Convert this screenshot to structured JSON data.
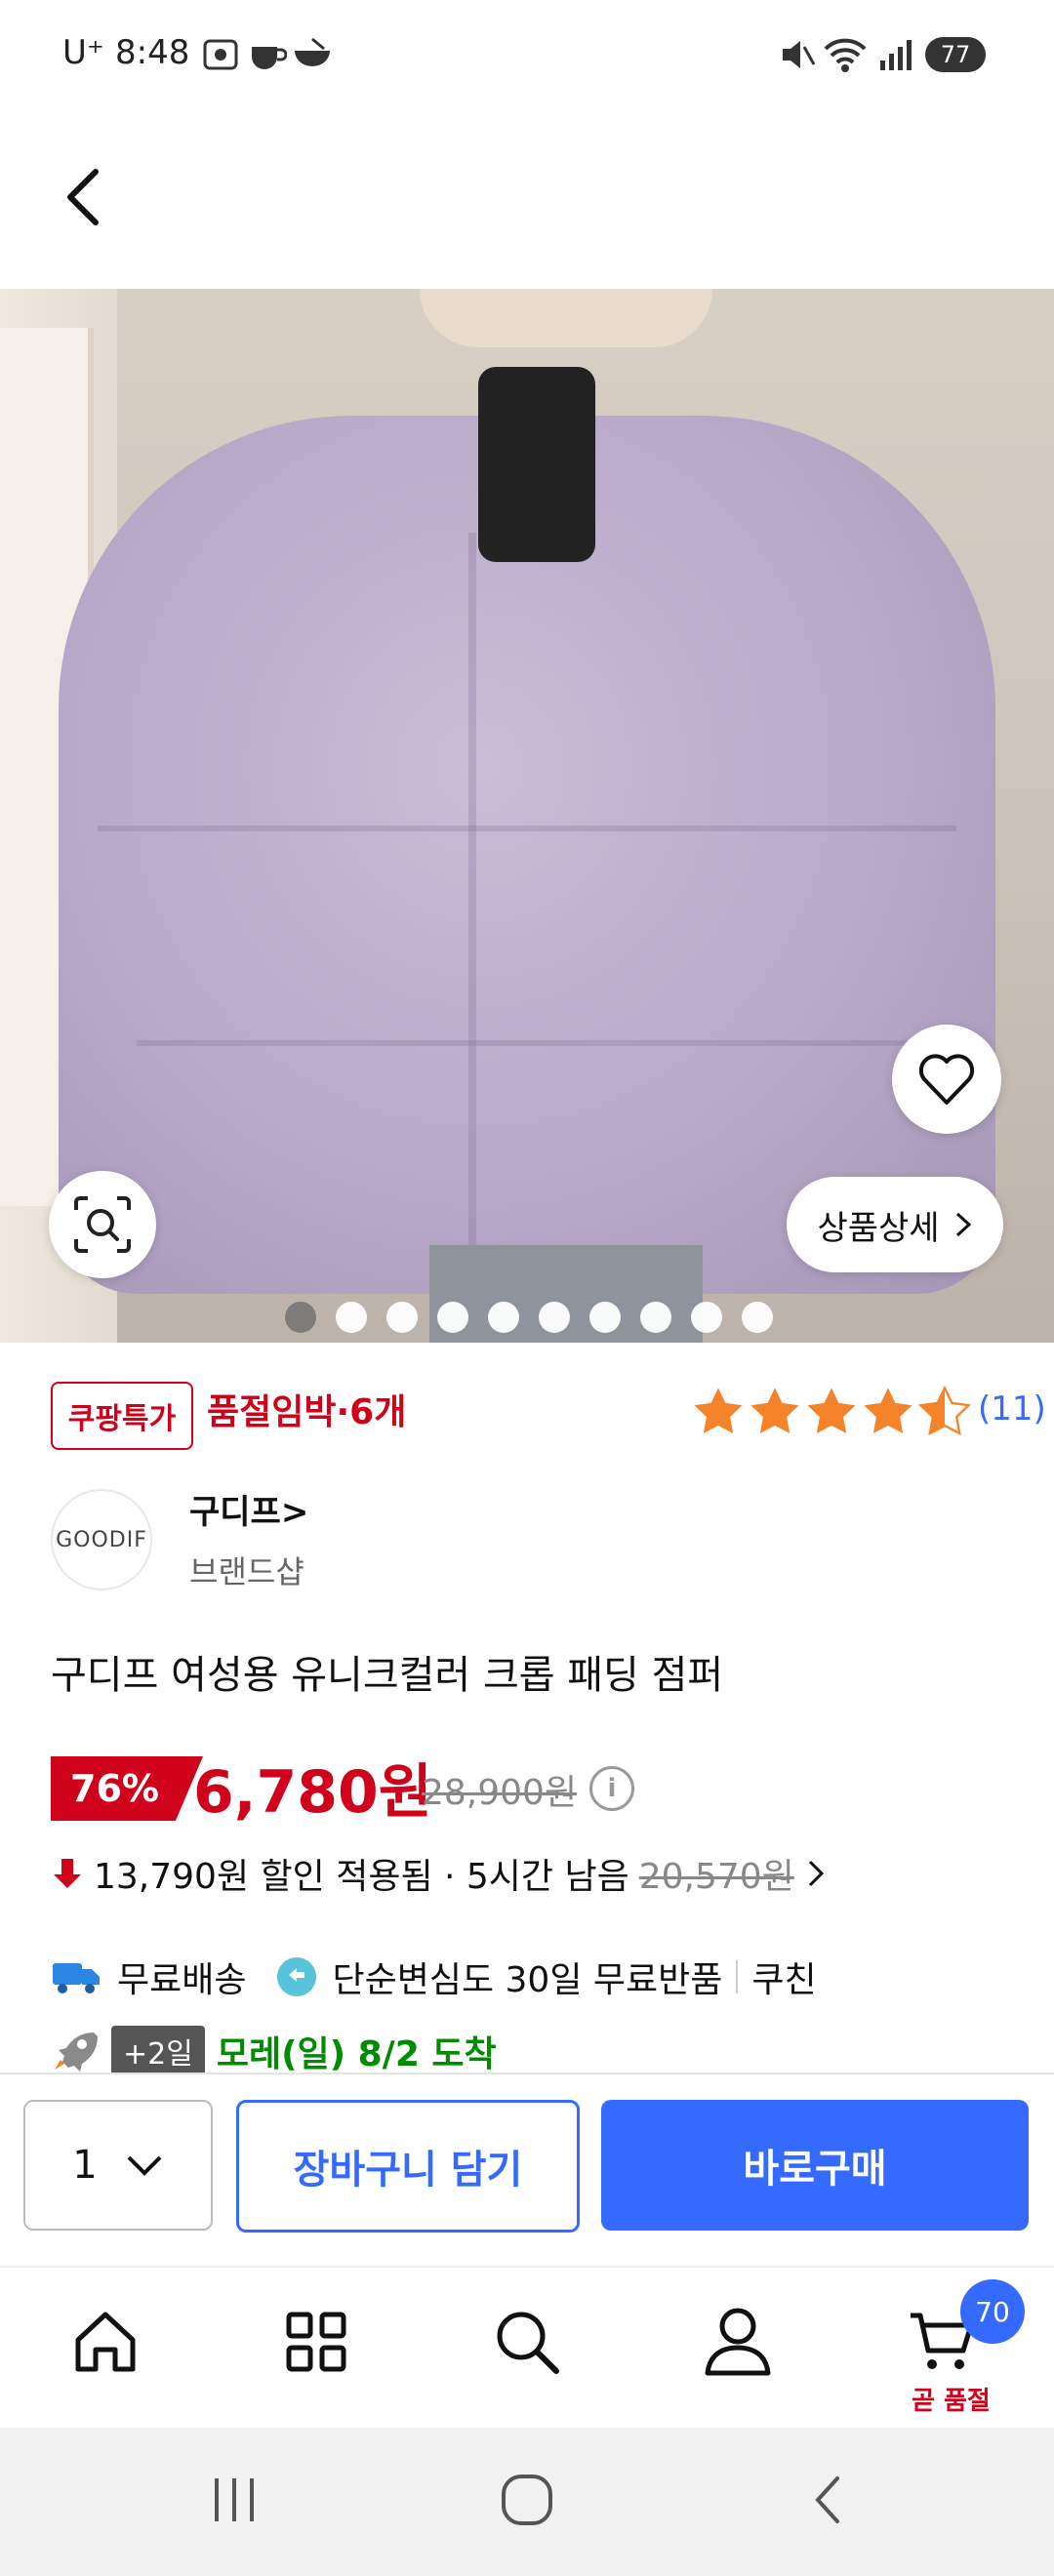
{
  "status_bar": {
    "carrier": "U⁺",
    "time": "8:48",
    "battery": "77"
  },
  "header": {
    "back_icon": "chevron-left-icon"
  },
  "product_image": {
    "detail_button_label": "상품상세",
    "image_count": 10,
    "active_index": 0
  },
  "badges": {
    "coupang_special": "쿠팡특가",
    "stock_status": "품절임박·6개"
  },
  "rating": {
    "stars": 4.5,
    "review_count": "(11)"
  },
  "brand": {
    "logo_text": "GOODIF",
    "name": "구디프>",
    "subtitle": "브랜드샵"
  },
  "product": {
    "title": "구디프 여성용 유니크컬러 크롭 패딩 점퍼",
    "discount": "76%",
    "price": "6,780원",
    "original_price": "28,900원",
    "coupon_text": "13,790원 할인 적용됨 · 5시간 남음",
    "coupon_strike": "20,570원"
  },
  "shipping": {
    "free_shipping": "무료배송",
    "return_text": "단순변심도 30일 무료반품",
    "coocheen": "쿠친",
    "plus_days": "+2일",
    "arrival": "모레(일) 8/2 도착"
  },
  "actions": {
    "quantity": "1",
    "add_to_cart": "장바구니 담기",
    "buy_now": "바로구매"
  },
  "bottom_nav": {
    "cart_count": "70",
    "cart_label": "곧 품절"
  },
  "colors": {
    "accent_blue": "#346aff",
    "price_red": "#d0021b",
    "star_orange": "#f5832a",
    "arrival_green": "#008c00"
  }
}
